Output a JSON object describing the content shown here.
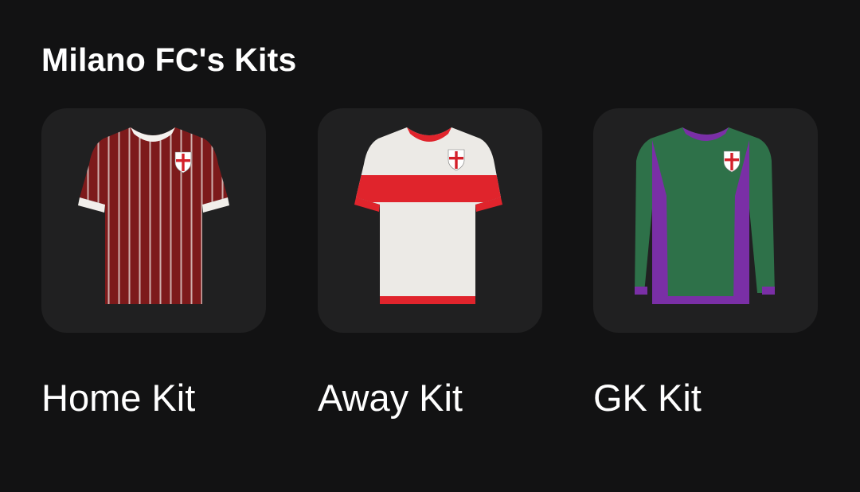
{
  "section": {
    "title": "Milano FC's Kits"
  },
  "kits": [
    {
      "label": "Home Kit",
      "colors": {
        "base": "#8c1d1f",
        "stripe": "#e7c3c0",
        "collar": "#f4f1ee",
        "cuff": "#f1eeea"
      }
    },
    {
      "label": "Away Kit",
      "colors": {
        "base": "#eceae6",
        "band": "#e0242c",
        "collar": "#e0242c",
        "cuff": "#e0242c"
      }
    },
    {
      "label": "GK Kit",
      "colors": {
        "base": "#2e7149",
        "panel": "#7a2fa6",
        "collar": "#7a2fa6",
        "cuff": "#7a2fa6"
      }
    }
  ],
  "crest": {
    "colors": {
      "shield": "#ffffff",
      "cross": "#d4202a"
    }
  },
  "icons": [
    "shirt-icon",
    "shield-crest-icon"
  ]
}
